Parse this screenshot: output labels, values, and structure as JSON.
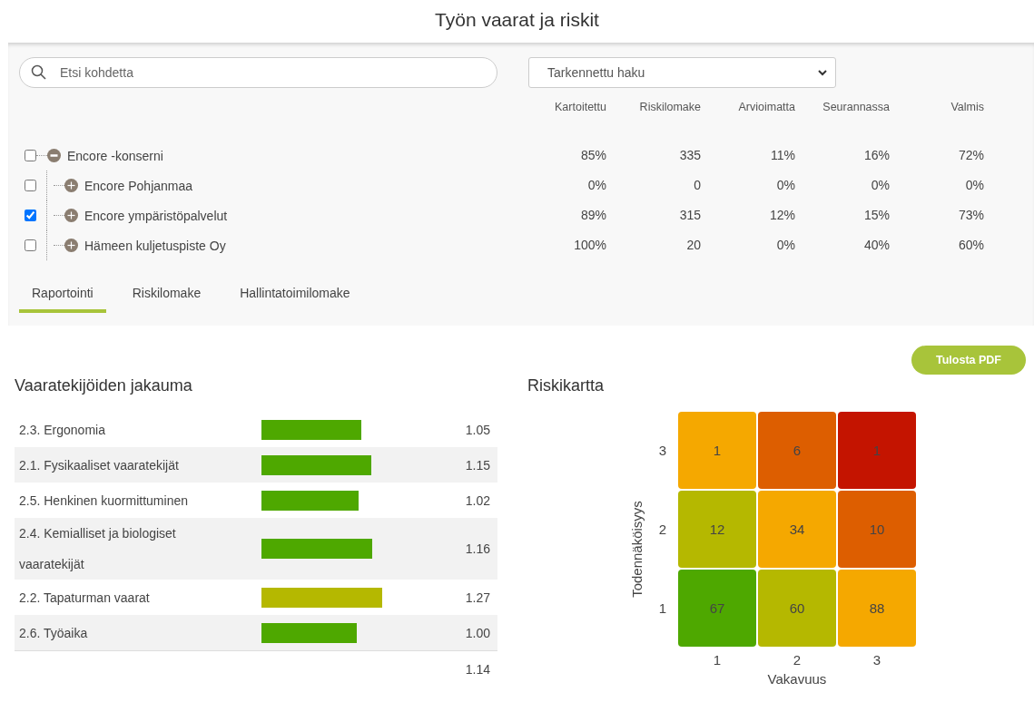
{
  "title": "Työn vaarat ja riskit",
  "search": {
    "placeholder": "Etsi kohdetta"
  },
  "filter_select": {
    "value": "Tarkennettu haku"
  },
  "columns": [
    "Kartoitettu",
    "Riskilomake",
    "Arvioimatta",
    "Seurannassa",
    "Valmis"
  ],
  "tree": [
    {
      "label": "Encore -konserni",
      "checked": false,
      "expanded": true,
      "cells": [
        "85%",
        "335",
        "11%",
        "16%",
        "72%"
      ],
      "children": [
        {
          "label": "Encore Pohjanmaa",
          "checked": false,
          "expanded": false,
          "cells": [
            "0%",
            "0",
            "0%",
            "0%",
            "0%"
          ]
        },
        {
          "label": "Encore ympäristöpalvelut",
          "checked": true,
          "expanded": false,
          "cells": [
            "89%",
            "315",
            "12%",
            "15%",
            "73%"
          ]
        },
        {
          "label": "Hämeen kuljetuspiste Oy",
          "checked": false,
          "expanded": false,
          "cells": [
            "100%",
            "20",
            "0%",
            "40%",
            "60%"
          ]
        }
      ]
    }
  ],
  "tabs": [
    {
      "label": "Raportointi",
      "selected": true
    },
    {
      "label": "Riskilomake",
      "selected": false
    },
    {
      "label": "Hallintatoimilomake",
      "selected": false
    }
  ],
  "pdf_button": "Tulosta PDF",
  "distribution": {
    "title": "Vaaratekijöiden jakauma",
    "rows": [
      {
        "label": "2.3. Ergonomia",
        "color": "#4ea800",
        "value": "1.05"
      },
      {
        "label": "2.1. Fysikaaliset vaaratekijät",
        "color": "#4ea800",
        "value": "1.15"
      },
      {
        "label": "2.5. Henkinen kuormittuminen",
        "color": "#4ea800",
        "value": "1.02"
      },
      {
        "label": "2.4. Kemialliset ja biologiset vaaratekijät",
        "color": "#4ea800",
        "value": "1.16"
      },
      {
        "label": "2.2. Tapaturman vaarat",
        "color": "#b5b800",
        "value": "1.27"
      },
      {
        "label": "2.6. Työaika",
        "color": "#4ea800",
        "value": "1.00"
      }
    ],
    "total": "1.14"
  },
  "risk_map": {
    "title": "Riskikartta",
    "y_label": "Todennäköisyys",
    "x_label": "Vakavuus",
    "x_ticks": [
      "1",
      "2",
      "3"
    ],
    "rows": [
      {
        "tick": "3",
        "cells": [
          {
            "value": "1",
            "color": "#f5a800"
          },
          {
            "value": "6",
            "color": "#dd5e00"
          },
          {
            "value": "1",
            "color": "#c41400"
          }
        ]
      },
      {
        "tick": "2",
        "cells": [
          {
            "value": "12",
            "color": "#b5b800"
          },
          {
            "value": "34",
            "color": "#f5a800"
          },
          {
            "value": "10",
            "color": "#dd5e00"
          }
        ]
      },
      {
        "tick": "1",
        "cells": [
          {
            "value": "67",
            "color": "#4ea800"
          },
          {
            "value": "60",
            "color": "#b5b800"
          },
          {
            "value": "88",
            "color": "#f5a800"
          }
        ]
      }
    ]
  }
}
